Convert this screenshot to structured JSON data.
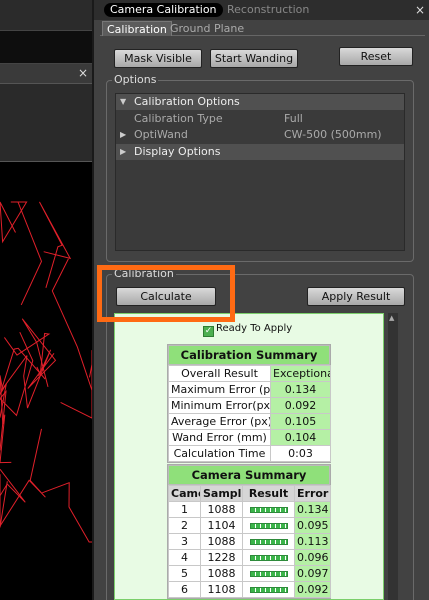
{
  "window": {
    "tab_active": "Camera Calibration",
    "tab_inactive": "Reconstruction",
    "close_glyph": "×"
  },
  "left_viewport": {
    "close_glyph": "×",
    "line_color": "#e0202a"
  },
  "subtabs": [
    "Calibration",
    "Ground Plane"
  ],
  "buttons": {
    "mask_visible": "Mask Visible",
    "start_wanding": "Start Wanding",
    "reset": "Reset",
    "calculate": "Calculate",
    "apply_result": "Apply Result"
  },
  "options": {
    "title": "Options",
    "calibration_options": "Calibration Options",
    "rows": [
      {
        "label": "Calibration Type",
        "value": "Full"
      },
      {
        "label": "OptiWand",
        "value": "CW-500 (500mm)"
      }
    ],
    "display_options": "Display Options"
  },
  "calibration": {
    "title": "Calibration",
    "status": "Ready To Apply",
    "summary": {
      "title": "Calibration Summary",
      "rows": [
        {
          "label": "Overall Result",
          "value": "Exceptional"
        },
        {
          "label": "Maximum Error (px)",
          "value": "0.134"
        },
        {
          "label": "Minimum Error(px)",
          "value": "0.092"
        },
        {
          "label": "Average Error (px)",
          "value": "0.105"
        },
        {
          "label": "Wand Error (mm)",
          "value": "0.104"
        },
        {
          "label": "Calculation Time",
          "value": "0:03"
        }
      ]
    },
    "camera_summary": {
      "title": "Camera Summary",
      "headers": [
        "Camera",
        "Samples",
        "Result",
        "Error"
      ],
      "rows": [
        {
          "camera": "1",
          "samples": "1088",
          "error": "0.134"
        },
        {
          "camera": "2",
          "samples": "1104",
          "error": "0.095"
        },
        {
          "camera": "3",
          "samples": "1088",
          "error": "0.113"
        },
        {
          "camera": "4",
          "samples": "1228",
          "error": "0.096"
        },
        {
          "camera": "5",
          "samples": "1088",
          "error": "0.097"
        },
        {
          "camera": "6",
          "samples": "1108",
          "error": "0.092"
        }
      ]
    }
  },
  "colors": {
    "highlight": "#ff6a13",
    "accent_green": "#8fe07a"
  },
  "icons": {
    "checkbox": "check-icon",
    "expand": "triangle-down-icon",
    "collapse": "triangle-right-icon"
  }
}
